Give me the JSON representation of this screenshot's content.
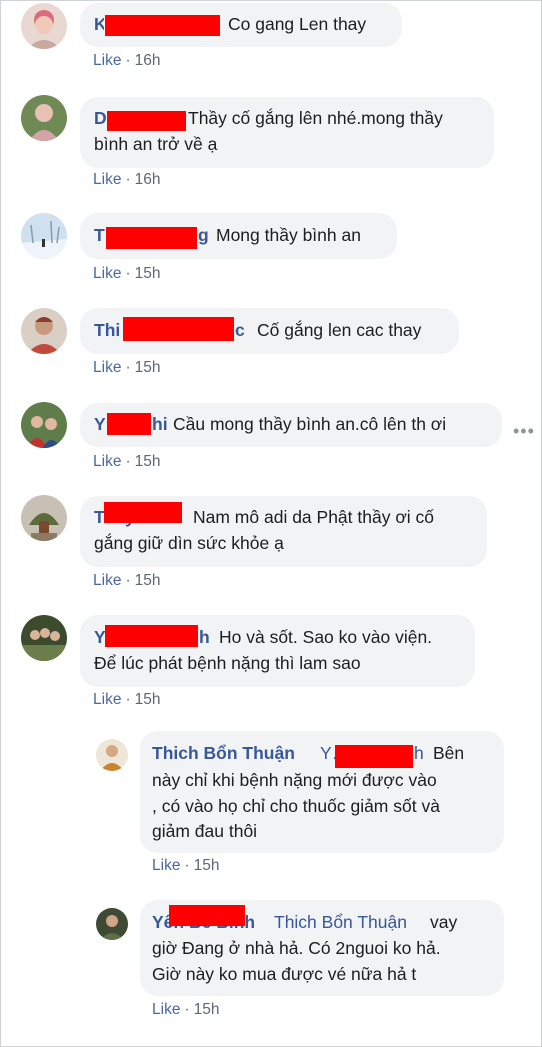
{
  "comments": [
    {
      "author": "Kh…n",
      "text": "Co gang Len thay",
      "like": "Like",
      "time": "16h"
    },
    {
      "author": "D…",
      "text_line1": "Thầy cố gắng lên nhé.mong thầy",
      "text_line2": "bình an trở về ạ",
      "like": "Like",
      "time": "16h"
    },
    {
      "author": "T…g",
      "text": "Mong thầy bình an",
      "like": "Like",
      "time": "15h"
    },
    {
      "author": "Thi…c",
      "text": "Cố gắng len cac thay",
      "like": "Like",
      "time": "15h"
    },
    {
      "author": "Y…hi",
      "text": "Cầu mong thầy bình an.cô lên th ơi",
      "like": "Like",
      "time": "15h",
      "more": "•••"
    },
    {
      "author": "Thầy Trần",
      "text_line1": "Nam mô adi da Phật thầy ơi cố",
      "text_line2": "gắng giữ dìn sức khỏe ạ",
      "like": "Like",
      "time": "15h"
    },
    {
      "author": "Y…nh",
      "text_line1": "Ho và sốt. Sao ko vào viện.",
      "text_line2": "Để lúc phát bệnh nặng thì lam sao",
      "like": "Like",
      "time": "15h"
    }
  ],
  "replies": [
    {
      "author": "Thich Bổn Thuận",
      "mention": "Y…nh",
      "text_line1": "Bên",
      "text_line2": "này chỉ khi bệnh nặng mới được vào",
      "text_line3": ", có vào họ chỉ cho thuốc giảm sốt và",
      "text_line4": "giảm đau thôi",
      "like": "Like",
      "time": "15h"
    },
    {
      "author": "Yên Bé Bình",
      "mention": "Thich Bổn Thuận",
      "text_line1": "vay",
      "text_line2": "giờ Đang ở nhà hả. Có 2nguoi ko hả.",
      "text_line3": "Giờ này ko mua được vé nữa hả t",
      "like": "Like",
      "time": "15h"
    }
  ]
}
